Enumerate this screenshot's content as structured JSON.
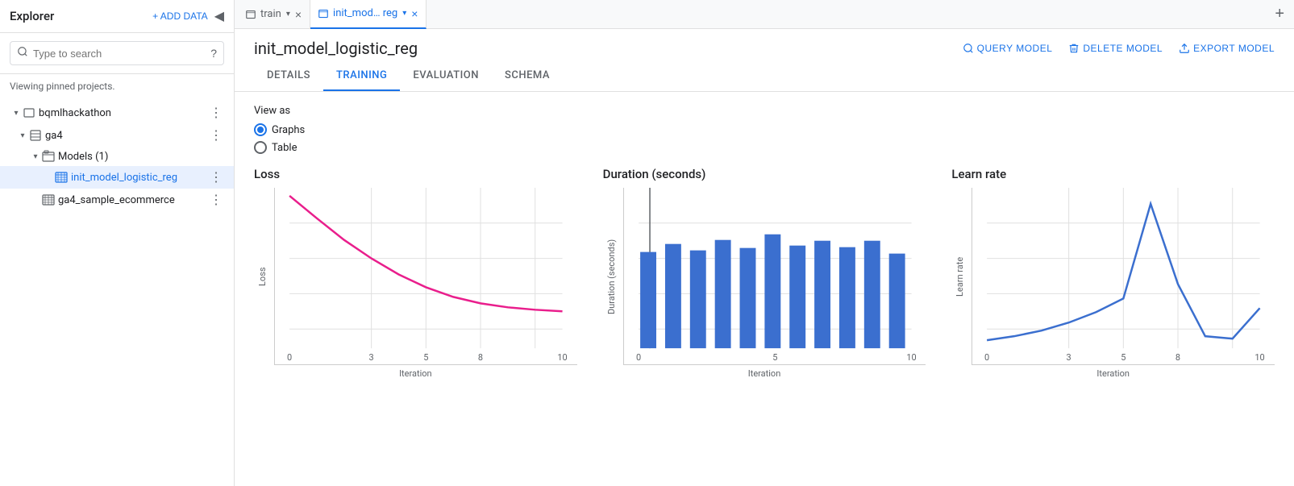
{
  "sidebar": {
    "title": "Explorer",
    "add_data_label": "+ ADD DATA",
    "search_placeholder": "Type to search",
    "pinned_label": "Viewing pinned projects.",
    "tree": [
      {
        "id": "bqmlhackathon",
        "level": 0,
        "label": "bqmlhackathon",
        "type": "project",
        "expanded": true
      },
      {
        "id": "ga4",
        "level": 1,
        "label": "ga4",
        "type": "dataset",
        "expanded": true
      },
      {
        "id": "models",
        "level": 2,
        "label": "Models (1)",
        "type": "models",
        "expanded": true
      },
      {
        "id": "init_model_logistic_reg",
        "level": 3,
        "label": "init_model_logistic_reg",
        "type": "model",
        "selected": true
      },
      {
        "id": "ga4_sample_ecommerce",
        "level": 2,
        "label": "ga4_sample_ecommerce",
        "type": "table"
      }
    ]
  },
  "tabs": [
    {
      "id": "train",
      "label": "train",
      "closable": true
    },
    {
      "id": "init_mod_reg",
      "label": "init_mod… reg",
      "closable": true,
      "active": true
    }
  ],
  "page": {
    "title": "init_model_logistic_reg",
    "actions": {
      "query_model": "QUERY MODEL",
      "delete_model": "DELETE MODEL",
      "export_model": "EXPORT MODEL"
    },
    "nav_tabs": [
      "DETAILS",
      "TRAINING",
      "EVALUATION",
      "SCHEMA"
    ],
    "active_tab": "TRAINING"
  },
  "training": {
    "view_as_label": "View as",
    "view_graphs_label": "Graphs",
    "view_table_label": "Table",
    "selected_view": "Graphs",
    "charts": {
      "loss": {
        "title": "Loss",
        "x_label": "Iteration",
        "y_label": "Loss",
        "x_ticks": [
          "0",
          "3",
          "5",
          "8",
          "10"
        ],
        "data": [
          0.95,
          0.72,
          0.52,
          0.38,
          0.29,
          0.23,
          0.19,
          0.17,
          0.15,
          0.14,
          0.13
        ]
      },
      "duration": {
        "title": "Duration (seconds)",
        "x_label": "Iteration",
        "y_label": "Duration (seconds)",
        "x_ticks": [
          "0",
          "5",
          "10"
        ],
        "bars": [
          0.62,
          0.72,
          0.65,
          0.75,
          0.68,
          0.78,
          0.7,
          0.73,
          0.68,
          0.73,
          0.6
        ]
      },
      "learn_rate": {
        "title": "Learn rate",
        "x_label": "Iteration",
        "y_label": "Learn rate",
        "x_ticks": [
          "0",
          "3",
          "5",
          "8",
          "10"
        ],
        "data": [
          0.05,
          0.08,
          0.12,
          0.18,
          0.28,
          0.45,
          0.9,
          0.55,
          0.15,
          0.12,
          0.3
        ]
      }
    }
  },
  "icons": {
    "search": "🔍",
    "help": "?",
    "add": "+",
    "collapse": "◀",
    "more": "⋮",
    "close": "×",
    "chevron": "▾",
    "expand": "▶",
    "expanded": "▾",
    "query": "🔍",
    "delete": "🗑",
    "export": "↑",
    "table_icon": "⊞",
    "model_icon": "⊞"
  },
  "colors": {
    "primary": "#1a73e8",
    "selected_bg": "#e8f0fe",
    "loss_line": "#e91e8c",
    "duration_bar": "#3b6fcf",
    "learn_rate_line": "#3b6fcf",
    "grid": "#e0e0e0",
    "axis": "#5f6368"
  }
}
